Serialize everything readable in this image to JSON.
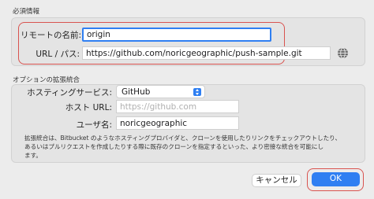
{
  "required": {
    "section_title": "必須情報",
    "remote_name_label": "リモートの名前:",
    "remote_name_value": "origin",
    "url_label": "URL / パス:",
    "url_value": "https://github.com/noricgeographic/push-sample.git"
  },
  "integration": {
    "section_title": "オプションの拡張統合",
    "hosting_label": "ホスティングサービス:",
    "hosting_value": "GitHub",
    "host_url_label": "ホスト URL:",
    "host_url_placeholder": "https://github.com",
    "username_label": "ユーザ名:",
    "username_value": "noricgeographic",
    "description_line1": "拡張統合は、Bitbucket のようなホスティングプロバイダと、クローンを使用したりリンクをチェックアウトしたり、",
    "description_line2": "あるいはプルリクエストを作成したりする際に既存のクローンを指定するといった、より密接な統合を可能にし",
    "description_line3": "ます。"
  },
  "buttons": {
    "cancel": "キャンセル",
    "ok": "OK"
  },
  "colors": {
    "accent": "#2f7ff2",
    "highlight_outline": "#d9534f"
  },
  "icons": {
    "globe": "globe-icon",
    "select_arrows": "chevron-updown-icon"
  }
}
